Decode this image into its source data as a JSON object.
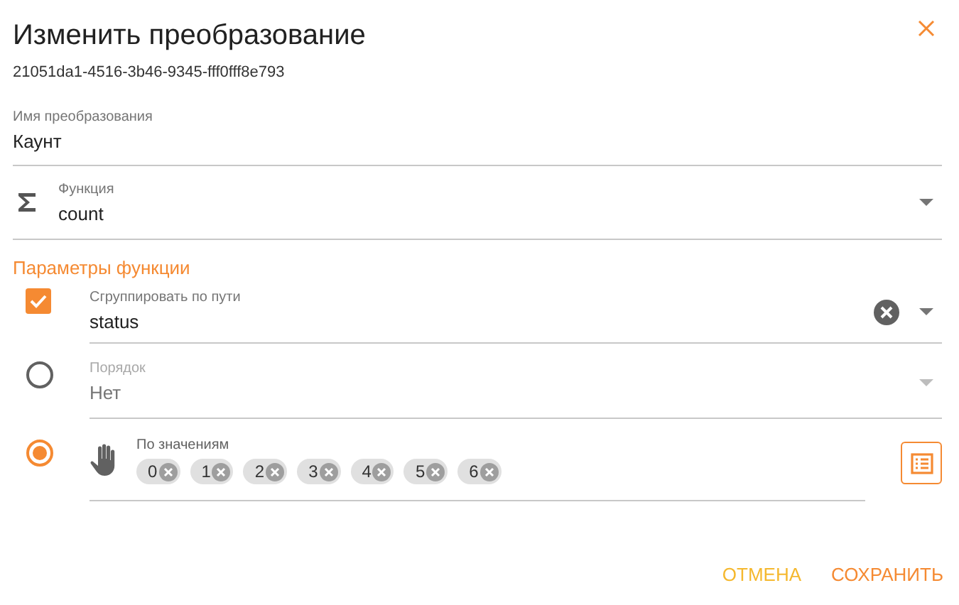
{
  "dialog": {
    "title": "Изменить преобразование",
    "subtitle": "21051da1-4516-3b46-9345-fff0fff8e793"
  },
  "name_field": {
    "label": "Имя преобразования",
    "value": "Каунт"
  },
  "function_field": {
    "label": "Функция",
    "value": "count"
  },
  "params_heading": "Параметры функции",
  "group_by": {
    "checked": true,
    "label": "Сгруппировать по пути",
    "value": "status"
  },
  "options": [
    {
      "kind": "select",
      "selected": false,
      "disabled": true,
      "label": "Порядок",
      "value": "Нет"
    },
    {
      "kind": "values",
      "selected": true,
      "label": "По значениям",
      "chips": [
        "0",
        "1",
        "2",
        "3",
        "4",
        "5",
        "6"
      ]
    }
  ],
  "buttons": [
    {
      "kind": "cancel",
      "label": "ОТМЕНА"
    },
    {
      "kind": "save",
      "label": "СОХРАНИТЬ"
    }
  ]
}
